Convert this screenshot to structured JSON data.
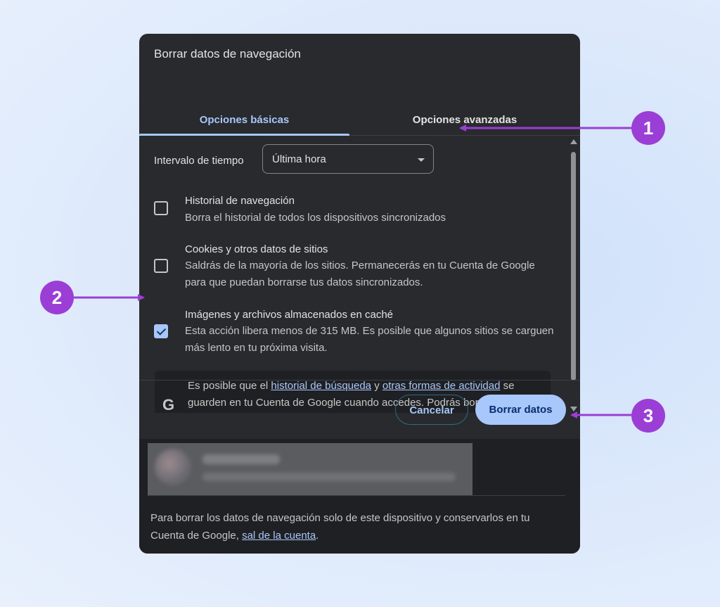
{
  "dialog": {
    "title": "Borrar datos de navegación",
    "tabs": [
      {
        "label": "Opciones básicas",
        "active": true
      },
      {
        "label": "Opciones avanzadas",
        "active": false
      }
    ],
    "time_range": {
      "label": "Intervalo de tiempo",
      "value": "Última hora"
    },
    "items": [
      {
        "title": "Historial de navegación",
        "desc": "Borra el historial de todos los dispositivos sincronizados",
        "checked": false
      },
      {
        "title": "Cookies y otros datos de sitios",
        "desc": "Saldrás de la mayoría de los sitios. Permanecerás en tu Cuenta de Google para que puedan borrarse tus datos sincronizados.",
        "checked": false
      },
      {
        "title": "Imágenes y archivos almacenados en caché",
        "desc": "Esta acción libera menos de 315 MB. Es posible que algunos sitios se carguen más lento en tu próxima visita.",
        "checked": true
      }
    ],
    "google_notice": {
      "pre": "Es posible que el ",
      "link1": "historial de búsqueda",
      "mid": " y ",
      "link2": "otras formas de actividad",
      "post": " se guarden en tu Cuenta de Google cuando accedes. Podrás borrarlas en"
    },
    "buttons": {
      "cancel": "Cancelar",
      "clear": "Borrar datos"
    },
    "footer_note": {
      "text": "Para borrar los datos de navegación solo de este dispositivo y conservarlos en tu Cuenta de Google, ",
      "link": "sal de la cuenta",
      "end": "."
    }
  },
  "annotations": [
    {
      "number": "1"
    },
    {
      "number": "2"
    },
    {
      "number": "3"
    }
  ],
  "colors": {
    "accent": "#a8c7fa",
    "annotation": "#9b3ed6",
    "dialog_bg": "#282a2d"
  }
}
